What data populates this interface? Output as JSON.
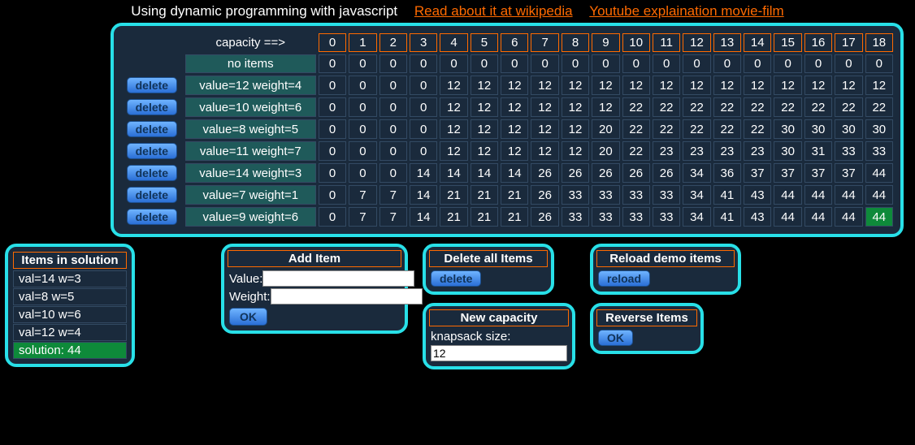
{
  "header": {
    "tagline": "Using dynamic programming with javascript",
    "link1": "Read about it at wikipedia",
    "link2": "Youtube explaination movie-film"
  },
  "table": {
    "capacity_label": "capacity ==>",
    "delete_label": "delete",
    "no_items_label": "no items",
    "capacities": [
      0,
      1,
      2,
      3,
      4,
      5,
      6,
      7,
      8,
      9,
      10,
      11,
      12,
      13,
      14,
      15,
      16,
      17,
      18
    ],
    "rows": [
      {
        "label": "no items",
        "delete": false,
        "vals": [
          0,
          0,
          0,
          0,
          0,
          0,
          0,
          0,
          0,
          0,
          0,
          0,
          0,
          0,
          0,
          0,
          0,
          0,
          0
        ]
      },
      {
        "label": "value=12 weight=4",
        "delete": true,
        "vals": [
          0,
          0,
          0,
          0,
          12,
          12,
          12,
          12,
          12,
          12,
          12,
          12,
          12,
          12,
          12,
          12,
          12,
          12,
          12
        ]
      },
      {
        "label": "value=10 weight=6",
        "delete": true,
        "vals": [
          0,
          0,
          0,
          0,
          12,
          12,
          12,
          12,
          12,
          12,
          22,
          22,
          22,
          22,
          22,
          22,
          22,
          22,
          22
        ]
      },
      {
        "label": "value=8 weight=5",
        "delete": true,
        "vals": [
          0,
          0,
          0,
          0,
          12,
          12,
          12,
          12,
          12,
          20,
          22,
          22,
          22,
          22,
          22,
          30,
          30,
          30,
          30
        ]
      },
      {
        "label": "value=11 weight=7",
        "delete": true,
        "vals": [
          0,
          0,
          0,
          0,
          12,
          12,
          12,
          12,
          12,
          20,
          22,
          23,
          23,
          23,
          23,
          30,
          31,
          33,
          33
        ]
      },
      {
        "label": "value=14 weight=3",
        "delete": true,
        "vals": [
          0,
          0,
          0,
          14,
          14,
          14,
          14,
          26,
          26,
          26,
          26,
          26,
          34,
          36,
          37,
          37,
          37,
          37,
          44
        ]
      },
      {
        "label": "value=7 weight=1",
        "delete": true,
        "vals": [
          0,
          7,
          7,
          14,
          21,
          21,
          21,
          26,
          33,
          33,
          33,
          33,
          34,
          41,
          43,
          44,
          44,
          44,
          44
        ]
      },
      {
        "label": "value=9 weight=6",
        "delete": true,
        "vals": [
          0,
          7,
          7,
          14,
          21,
          21,
          21,
          26,
          33,
          33,
          33,
          33,
          34,
          41,
          43,
          44,
          44,
          44,
          44
        ],
        "highlight_last": true
      }
    ]
  },
  "solution": {
    "title": "Items in solution",
    "items": [
      "val=14 w=3",
      "val=8 w=5",
      "val=10 w=6",
      "val=12 w=4"
    ],
    "result": "solution: 44"
  },
  "add_item": {
    "title": "Add Item",
    "value_label": "Value:",
    "weight_label": "Weight:",
    "ok": "OK"
  },
  "delete_all": {
    "title": "Delete all Items",
    "btn": "delete"
  },
  "reload": {
    "title": "Reload demo items",
    "btn": "reload"
  },
  "new_cap": {
    "title": "New capacity",
    "label": "knapsack size:",
    "value": "12"
  },
  "reverse": {
    "title": "Reverse Items",
    "btn": "OK"
  }
}
